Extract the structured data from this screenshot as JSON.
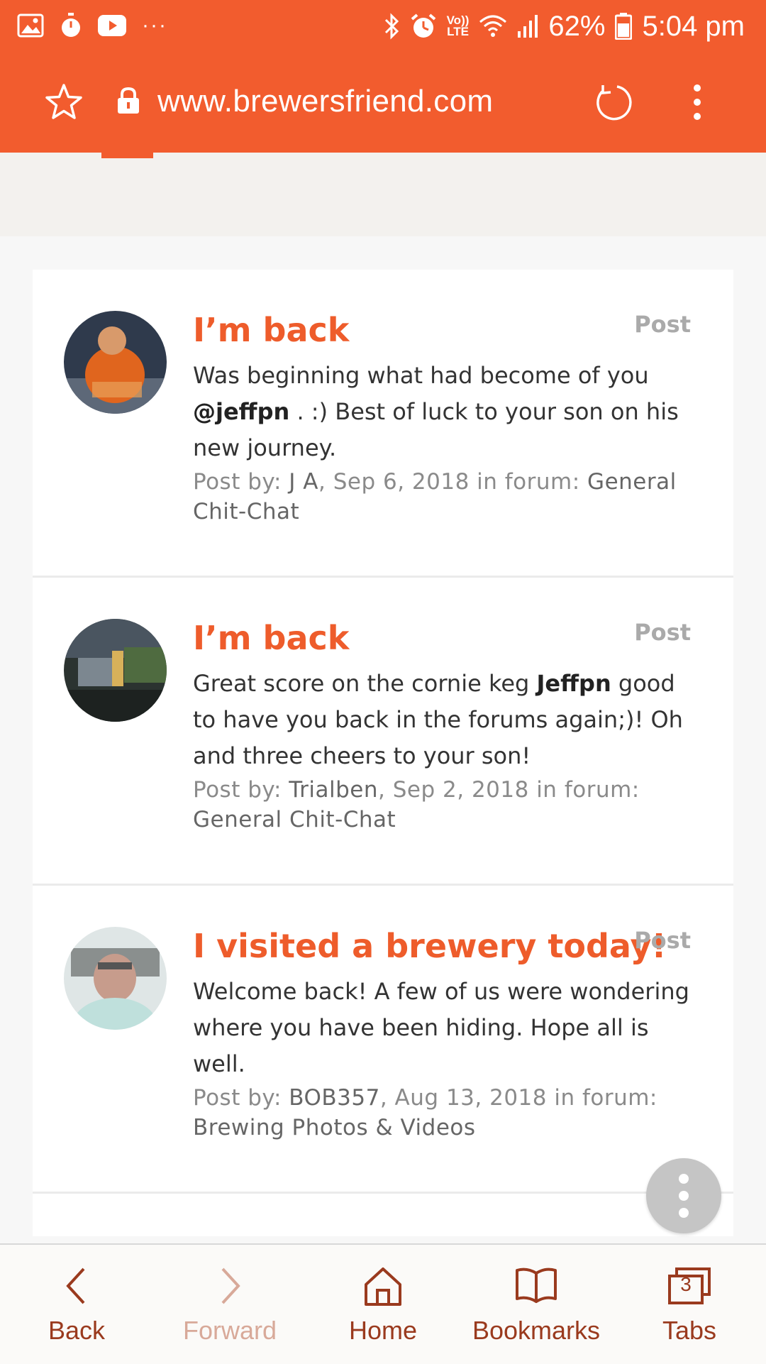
{
  "status_bar": {
    "battery": "62%",
    "time": "5:04 pm",
    "network_label_top": "Vo))",
    "network_label_bottom": "LTE",
    "left_icons": [
      "image-icon",
      "stopwatch-icon",
      "youtube-icon",
      "more-dots-icon"
    ],
    "overflow_dots": "···"
  },
  "browser": {
    "url": "www.brewersfriend.com"
  },
  "posts": [
    {
      "title": "I’m back",
      "type": "Post",
      "body_before": "Was beginning what had become of you ",
      "body_mention": "@jeffpn",
      "body_after": " . :) Best of luck to your son on his new journey.",
      "meta_prefix": "Post by: ",
      "author": "J A",
      "date": ", Sep 6, 2018 in forum: ",
      "forum": "General Chit-Chat"
    },
    {
      "title": "I’m back",
      "type": "Post",
      "body_before": "Great score on the cornie keg ",
      "body_mention": "Jeffpn",
      "body_after": " good to have you back in the forums again;)! Oh and three cheers to your son!",
      "meta_prefix": "Post by: ",
      "author": "Trialben",
      "date": ", Sep 2, 2018 in forum: ",
      "forum": "General Chit-Chat"
    },
    {
      "title": "I visited a brewery today!",
      "type": "Post",
      "body_before": "Welcome back! A few of us were wondering where you have been hiding. Hope all is well.",
      "body_mention": "",
      "body_after": "",
      "meta_prefix": "Post by: ",
      "author": "BOB357",
      "date": ", Aug 13, 2018 in forum: ",
      "forum": "Brewing Photos & Videos"
    }
  ],
  "bottom_nav": {
    "back": "Back",
    "forward": "Forward",
    "home": "Home",
    "bookmarks": "Bookmarks",
    "tabs": "Tabs",
    "tab_count": "3"
  },
  "colors": {
    "accent": "#f25c2e",
    "title": "#ee5c2b",
    "nav": "#9a3a1e"
  }
}
